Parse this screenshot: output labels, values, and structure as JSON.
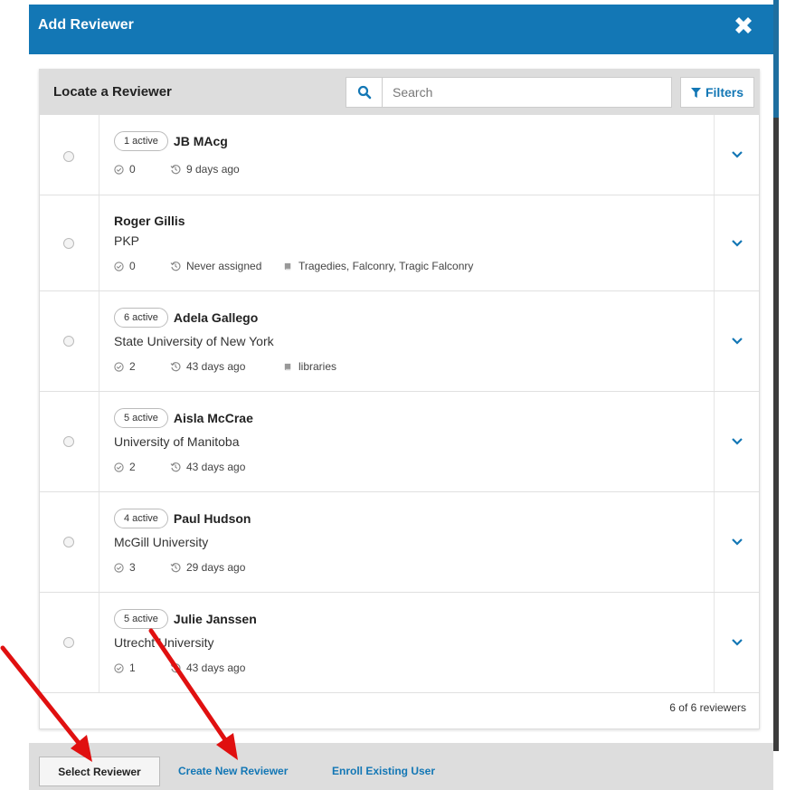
{
  "modal": {
    "title": "Add Reviewer"
  },
  "panel": {
    "title": "Locate a Reviewer",
    "search_placeholder": "Search",
    "filters_label": "Filters",
    "count_text": "6 of 6 reviewers"
  },
  "reviewers": [
    {
      "badge": "1 active",
      "name": "JB MAcg",
      "affiliation": "",
      "completed": "0",
      "last": "9 days ago",
      "interests": ""
    },
    {
      "badge": "",
      "name": "Roger Gillis",
      "affiliation": "PKP",
      "completed": "0",
      "last": "Never assigned",
      "interests": "Tragedies, Falconry, Tragic Falconry"
    },
    {
      "badge": "6 active",
      "name": "Adela Gallego",
      "affiliation": "State University of New York",
      "completed": "2",
      "last": "43 days ago",
      "interests": "libraries"
    },
    {
      "badge": "5 active",
      "name": "Aisla McCrae",
      "affiliation": "University of Manitoba",
      "completed": "2",
      "last": "43 days ago",
      "interests": ""
    },
    {
      "badge": "4 active",
      "name": "Paul Hudson",
      "affiliation": "McGill University",
      "completed": "3",
      "last": "29 days ago",
      "interests": ""
    },
    {
      "badge": "5 active",
      "name": "Julie Janssen",
      "affiliation": "Utrecht University",
      "completed": "1",
      "last": "43 days ago",
      "interests": ""
    }
  ],
  "footer": {
    "select_label": "Select Reviewer",
    "create_label": "Create New Reviewer",
    "enroll_label": "Enroll Existing User"
  },
  "colors": {
    "primary": "#1377b5",
    "header_gray": "#dddddd",
    "arrow_red": "#e01010"
  },
  "icons": [
    "close-icon",
    "search-icon",
    "filter-icon",
    "check-circle-icon",
    "history-icon",
    "book-icon",
    "chevron-down-icon"
  ]
}
